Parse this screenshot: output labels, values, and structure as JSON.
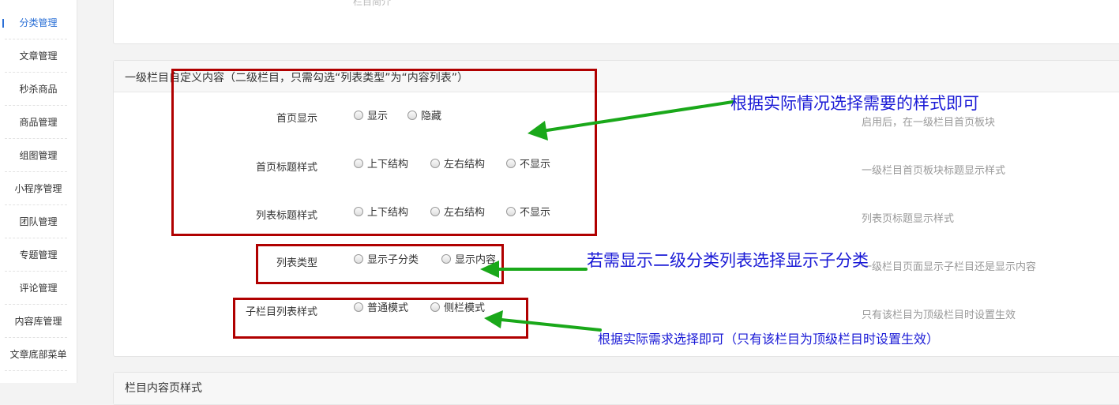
{
  "sidebar": {
    "items": [
      {
        "label": "分类管理",
        "active": true
      },
      {
        "label": "文章管理"
      },
      {
        "label": "秒杀商品"
      },
      {
        "label": "商品管理"
      },
      {
        "label": "组图管理"
      },
      {
        "label": "小程序管理"
      },
      {
        "label": "团队管理"
      },
      {
        "label": "专题管理"
      },
      {
        "label": "评论管理"
      },
      {
        "label": "内容库管理"
      },
      {
        "label": "文章底部菜单"
      }
    ]
  },
  "top_panel": {
    "faded_label": "栏目简介"
  },
  "main_panel": {
    "title": "一级栏目自定义内容（二级栏目，只需勾选“列表类型”为“内容列表”）",
    "rows": [
      {
        "label": "首页显示",
        "options": [
          "显示",
          "隐藏"
        ],
        "help": "启用后，在一级栏目首页板块"
      },
      {
        "label": "首页标题样式",
        "options": [
          "上下结构",
          "左右结构",
          "不显示"
        ],
        "help": "一级栏目首页板块标题显示样式"
      },
      {
        "label": "列表标题样式",
        "options": [
          "上下结构",
          "左右结构",
          "不显示"
        ],
        "help": "列表页标题显示样式"
      },
      {
        "label": "列表类型",
        "options": [
          "显示子分类",
          "显示内容"
        ],
        "help": "一级栏目页面显示子栏目还是显示内容"
      },
      {
        "label": "子栏目列表样式",
        "options": [
          "普通模式",
          "侧栏模式"
        ],
        "help": "只有该栏目为顶级栏目时设置生效"
      }
    ]
  },
  "bottom_panel": {
    "title": "栏目内容页样式"
  },
  "annotations": {
    "note1": "根据实际情况选择需要的样式即可",
    "note2": "若需显示二级分类列表选择显示子分类",
    "note3": "根据实际需求选择即可（只有该栏目为顶级栏目时设置生效）"
  },
  "colors": {
    "annotation_box": "#b00000",
    "annotation_arrow": "#1aa81a",
    "annotation_text": "#1a1ad6",
    "sidebar_active": "#2a6fd6"
  }
}
